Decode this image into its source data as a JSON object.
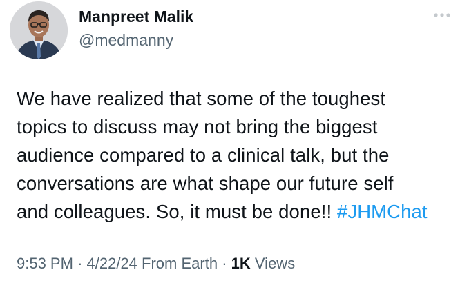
{
  "author": {
    "display_name": "Manpreet Malik",
    "handle": "@medmanny",
    "avatar_icon": "profile-photo"
  },
  "more_icon": "more-horizontal-icon",
  "tweet": {
    "lines": [
      "We have realized that some of the toughest",
      "topics to discuss may not bring the biggest",
      "audience compared to a clinical talk, but the",
      "conversations are what shape our future self",
      "and colleagues. So, it must be done!!"
    ],
    "hashtag": "#JHMChat"
  },
  "meta": {
    "time": "9:53 PM",
    "date": "4/22/24",
    "source": "From Earth",
    "separator": "·",
    "views_count": "1K",
    "views_label": "Views"
  },
  "colors": {
    "text": "#0f1419",
    "secondary": "#536471",
    "link": "#1d9bf0"
  }
}
